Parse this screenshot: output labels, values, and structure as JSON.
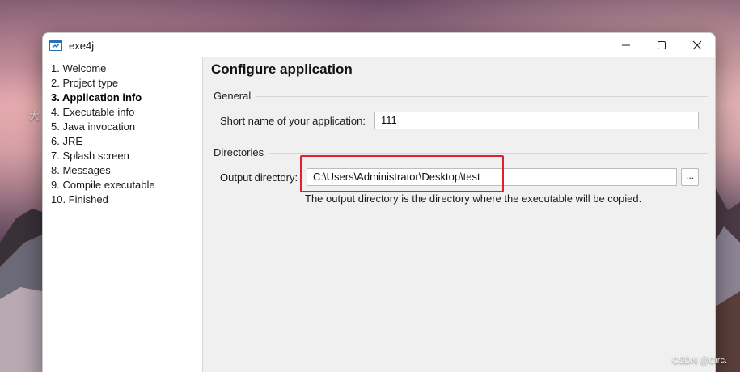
{
  "window": {
    "title": "exe4j",
    "icon": "exe4j-app-icon",
    "controls": {
      "minimize_icon": "minimize-icon",
      "maximize_icon": "maximize-icon",
      "close_icon": "close-icon"
    }
  },
  "steps": [
    {
      "label": "1. Welcome",
      "active": false
    },
    {
      "label": "2. Project type",
      "active": false
    },
    {
      "label": "3. Application info",
      "active": true
    },
    {
      "label": "4. Executable info",
      "active": false
    },
    {
      "label": "5. Java invocation",
      "active": false
    },
    {
      "label": "6. JRE",
      "active": false
    },
    {
      "label": "7. Splash screen",
      "active": false
    },
    {
      "label": "8. Messages",
      "active": false
    },
    {
      "label": "9. Compile executable",
      "active": false
    },
    {
      "label": "10. Finished",
      "active": false
    }
  ],
  "main": {
    "title": "Configure application",
    "general": {
      "header": "General",
      "short_name_label": "Short name of your application:",
      "short_name_value": "111"
    },
    "directories": {
      "header": "Directories",
      "output_label": "Output directory:",
      "output_value": "C:\\Users\\Administrator\\Desktop\\test",
      "browse_label": "...",
      "hint": "The output directory is the directory where the executable will be copied."
    }
  },
  "desktop": {
    "side_text": "大",
    "watermark": "CSDN @Circ."
  },
  "colors": {
    "highlight": "#e0202a",
    "active_step": "#000000"
  }
}
